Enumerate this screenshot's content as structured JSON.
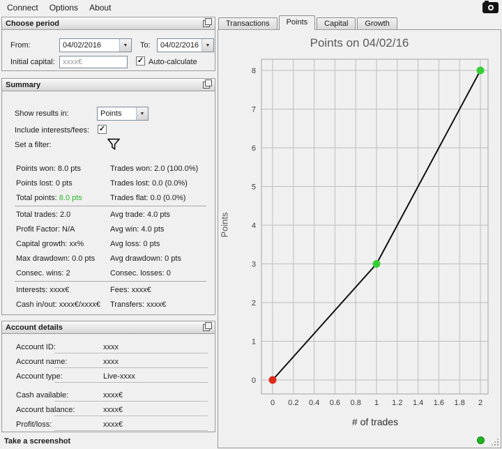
{
  "menu": {
    "items": [
      {
        "label": "Connect"
      },
      {
        "label": "Options"
      },
      {
        "label": "About"
      }
    ]
  },
  "choose_period": {
    "title": "Choose period",
    "from_label": "From:",
    "from_value": "04/02/2016",
    "to_label": "To:",
    "to_value": "04/02/2016",
    "initial_capital_label": "Initial capital:",
    "initial_capital_placeholder": "xxxx€",
    "auto_calculate_label": "Auto-calculate"
  },
  "summary": {
    "title": "Summary",
    "show_results_label": "Show results in:",
    "show_results_value": "Points",
    "include_label": "Include interests/fees:",
    "filter_label": "Set a filter:",
    "stats": [
      {
        "l": "Points won: 8.0 pts",
        "r": "Trades won: 2.0 (100.0%)"
      },
      {
        "l": "Points lost: 0 pts",
        "r": "Trades lost: 0.0 (0.0%)"
      },
      {
        "l_label": "Total points:",
        "l_value": "8.0 pts",
        "r": "Trades flat: 0.0 (0.0%)"
      },
      {
        "l": "Total trades: 2.0",
        "r": "Avg trade: 4.0 pts"
      },
      {
        "l": "Profit Factor: N/A",
        "r": "Avg win: 4.0 pts"
      },
      {
        "l": "Capital growth: xx%",
        "r": "Avg loss: 0 pts"
      },
      {
        "l": "Max drawdown: 0.0 pts",
        "r": "Avg drawdown: 0 pts"
      },
      {
        "l": "Consec. wins: 2",
        "r": "Consec. losses: 0"
      },
      {
        "l": "Interests: xxxx€",
        "r": "Fees: xxxx€"
      },
      {
        "l": "Cash in/out: xxxx€/xxxx€",
        "r": "Transfers: xxxx€"
      }
    ]
  },
  "account": {
    "title": "Account details",
    "rows": [
      {
        "label": "Account ID:",
        "value": "xxxx"
      },
      {
        "label": "Account name:",
        "value": "xxxx"
      },
      {
        "label": "Account type:",
        "value": "Live-xxxx"
      },
      {
        "label": "Cash available:",
        "value": "xxxx€"
      },
      {
        "label": "Account balance:",
        "value": "xxxx€"
      },
      {
        "label": "Profit/loss:",
        "value": "xxxx€"
      }
    ]
  },
  "footer": {
    "screenshot_label": "Take a screenshot"
  },
  "tabs": [
    {
      "label": "Transactions",
      "active": false
    },
    {
      "label": "Points",
      "active": true
    },
    {
      "label": "Capital",
      "active": false
    },
    {
      "label": "Growth",
      "active": false
    }
  ],
  "chart_data": {
    "type": "line",
    "title": "Points on 04/02/16",
    "xlabel": "# of trades",
    "ylabel": "Points",
    "x": [
      0,
      1,
      2
    ],
    "y": [
      0,
      3,
      8
    ],
    "point_colors": [
      "#dd2a1b",
      "#35cf35",
      "#35cf35"
    ],
    "line_color": "#111111",
    "xlim": [
      0,
      2
    ],
    "ylim": [
      0,
      8
    ],
    "xticks": [
      "0",
      "0.2",
      "0.4",
      "0.6",
      "0.8",
      "1",
      "1.2",
      "1.4",
      "1.6",
      "1.8",
      "2"
    ],
    "yticks": [
      "0",
      "1",
      "2",
      "3",
      "4",
      "5",
      "6",
      "7",
      "8"
    ],
    "grid": true,
    "legend": false
  },
  "colors": {
    "total_points_green": "#2db52d",
    "status_green": "#21b421",
    "grid": "#bdbdbd"
  }
}
